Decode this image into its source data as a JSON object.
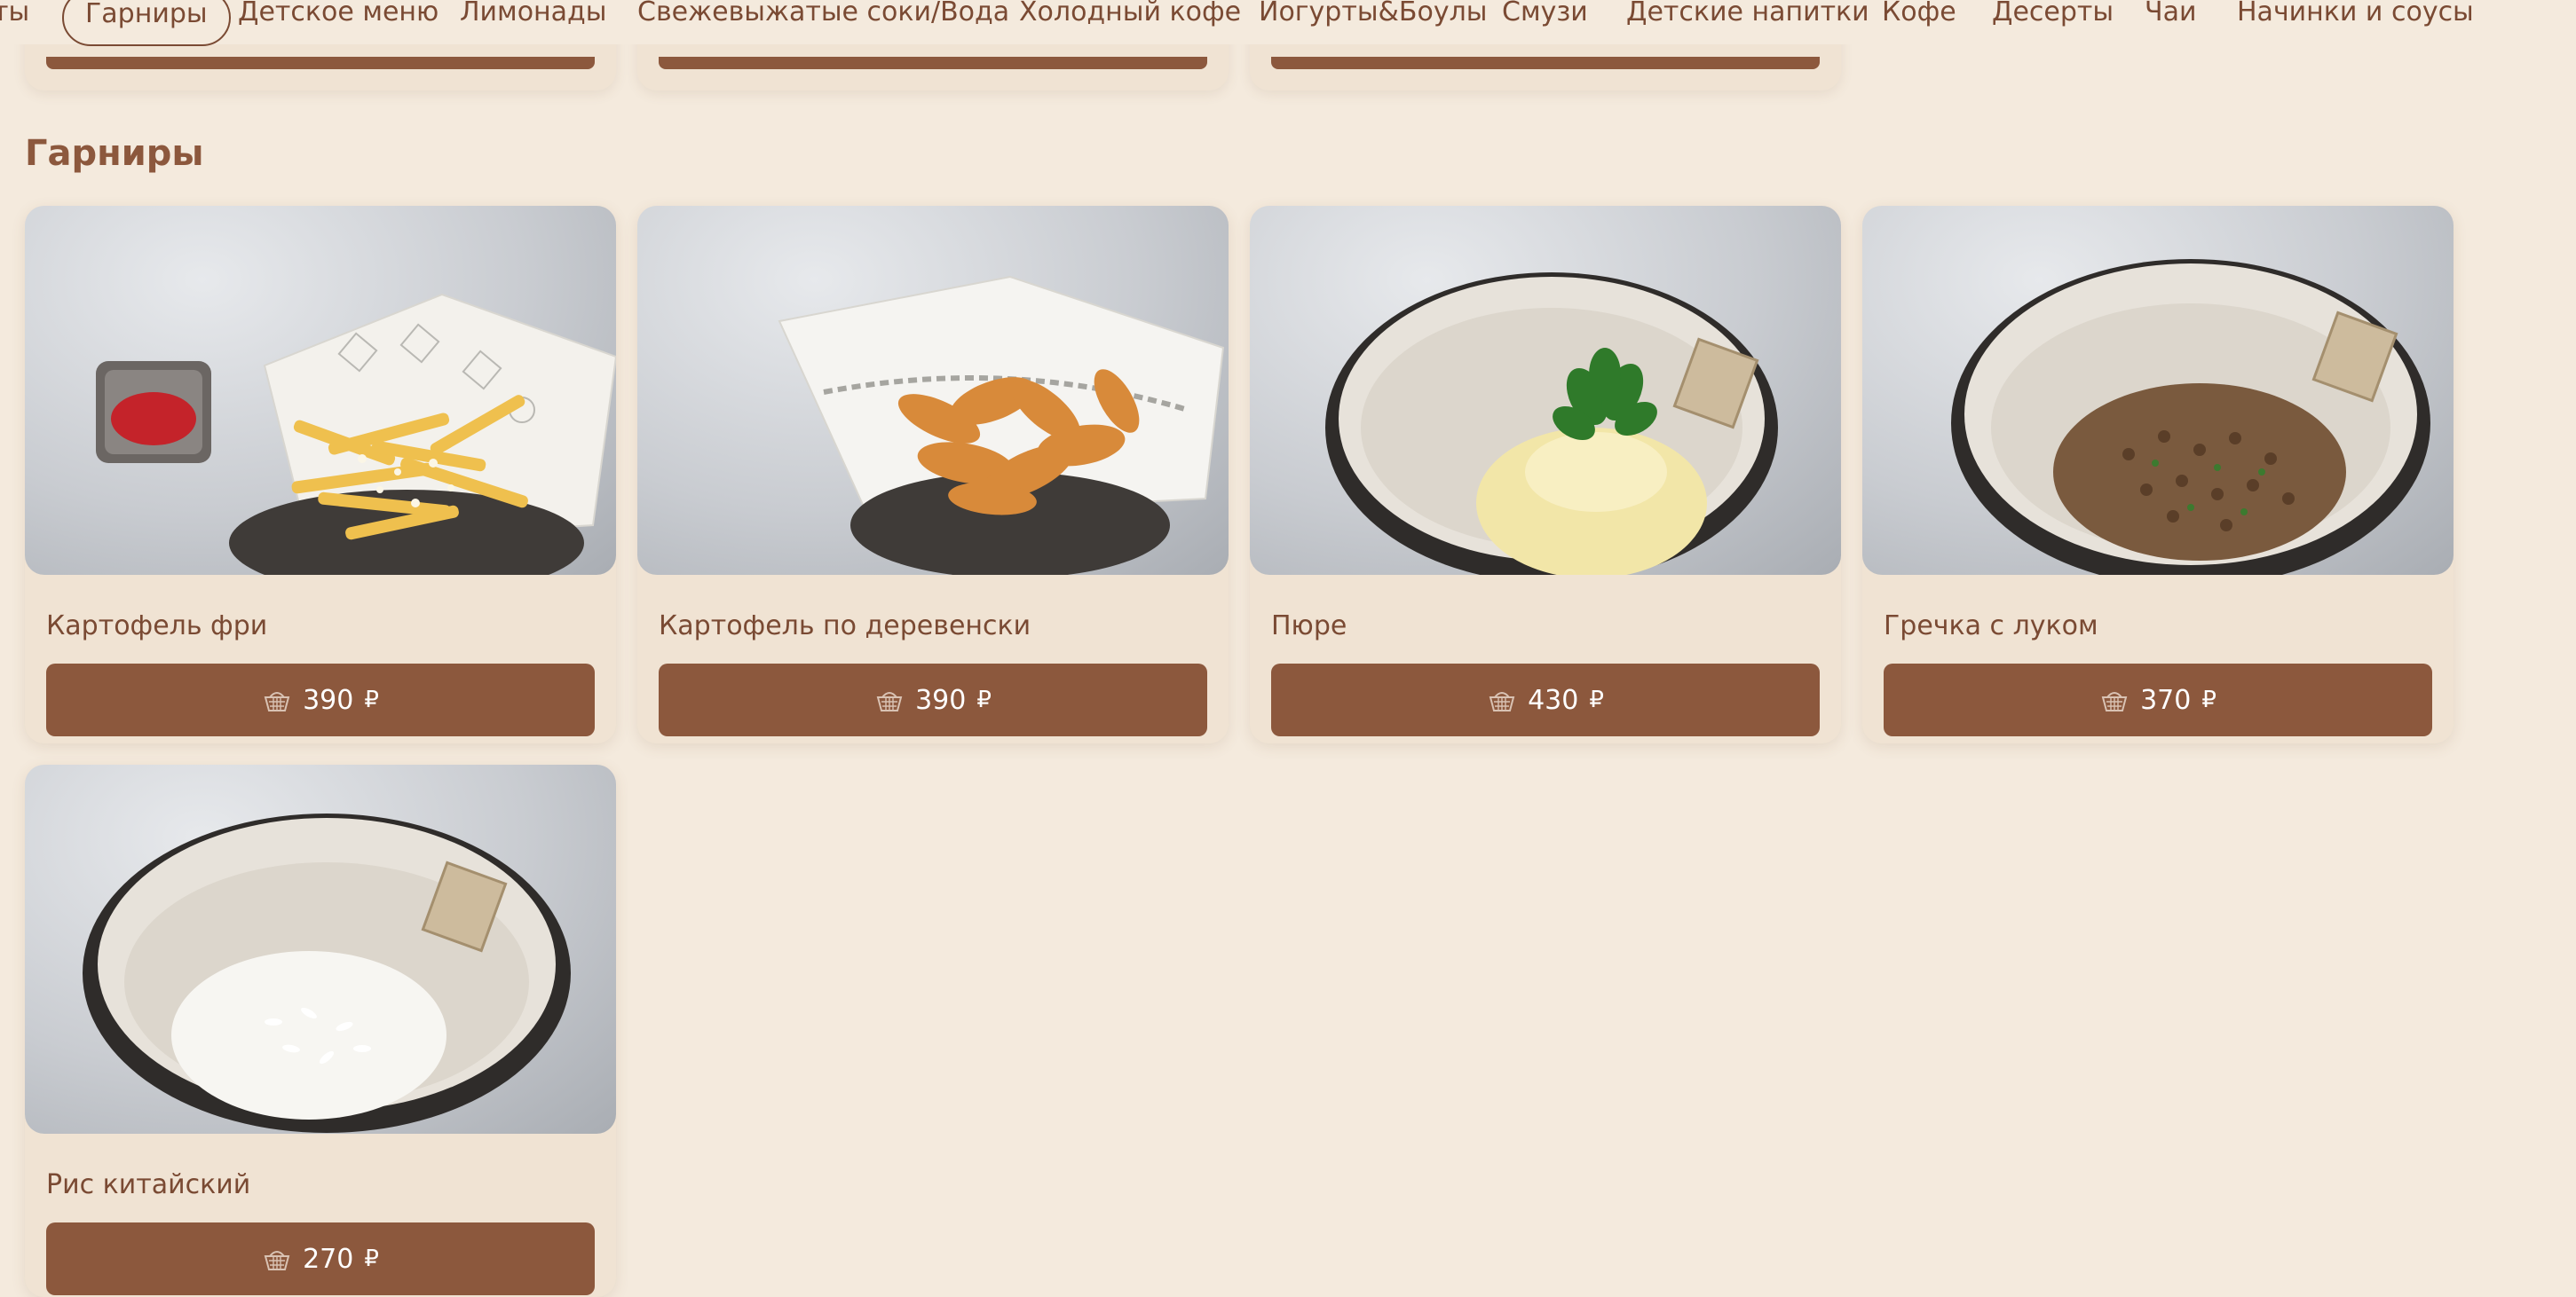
{
  "nav": {
    "items": [
      {
        "label": "ты"
      },
      {
        "label": "Гарниры",
        "active": true
      },
      {
        "label": "Детское меню"
      },
      {
        "label": "Лимонады"
      },
      {
        "label": "Свежевыжатые соки/Вода"
      },
      {
        "label": "Холодный кофе"
      },
      {
        "label": "Йогурты&Боулы"
      },
      {
        "label": "Смузи"
      },
      {
        "label": "Детские напитки"
      },
      {
        "label": "Кофе"
      },
      {
        "label": "Десерты"
      },
      {
        "label": "Чаи"
      },
      {
        "label": "Начинки и соусы"
      }
    ]
  },
  "section": {
    "title": "Гарниры",
    "currency": "₽",
    "items": [
      {
        "name": "Картофель фри",
        "price": "390",
        "image": "french-fries-photo"
      },
      {
        "name": "Картофель по деревенски",
        "price": "390",
        "image": "potato-wedges-photo"
      },
      {
        "name": "Пюре",
        "price": "430",
        "image": "mashed-potato-photo"
      },
      {
        "name": "Гречка с луком",
        "price": "370",
        "image": "buckwheat-with-onion-photo"
      },
      {
        "name": "Рис китайский",
        "price": "270",
        "image": "chinese-rice-photo"
      }
    ]
  },
  "colors": {
    "background": "#f4eadd",
    "card": "#f0e3d3",
    "accent": "#8c583d",
    "text": "#7a4a33"
  },
  "icons": {
    "buy": "basket-icon"
  }
}
